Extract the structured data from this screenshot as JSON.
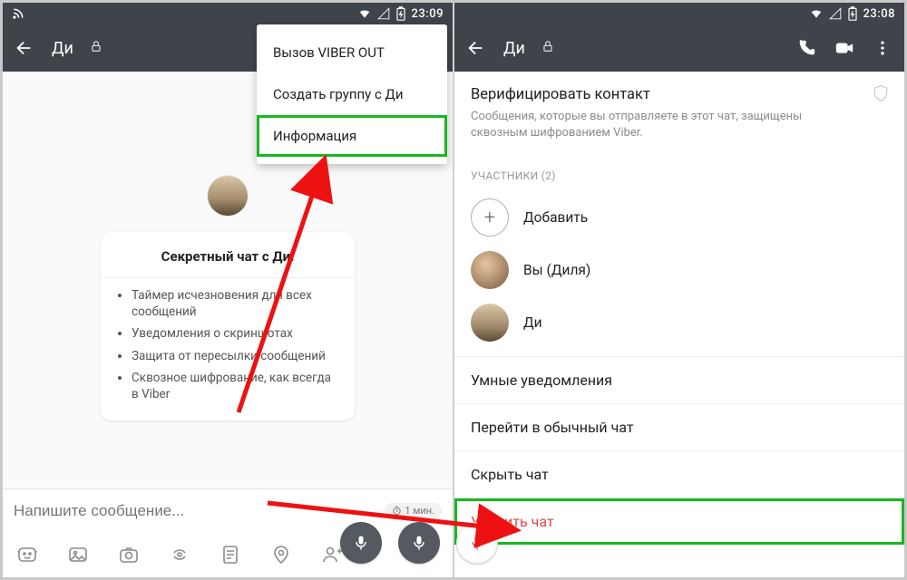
{
  "screen1": {
    "time": "23:09",
    "title": "Ди",
    "menu": {
      "item1": "Вызов VIBER OUT",
      "item2": "Создать группу с Ди",
      "item3": "Информация"
    },
    "secret_title": "Секретный чат с Ди:",
    "bullets": {
      "b1": "Таймер исчезновения для всех сообщений",
      "b2": "Уведомления о скриншотах",
      "b3": "Защита от пересылки сообщений",
      "b4": "Сквозное шифрование, как всегда в Viber"
    },
    "input_placeholder": "Напишите сообщение...",
    "timer_chip": "1 мин."
  },
  "screen2": {
    "time": "23:08",
    "title": "Ди",
    "verify_title": "Верифицировать контакт",
    "verify_sub": "Сообщения, которые вы отправляете в этот чат, защищены сквозным шифрованием Viber.",
    "participants_label": "УЧАСТНИКИ (2)",
    "add_label": "Добавить",
    "you_label": "Вы (Диля)",
    "other_label": "Ди",
    "opt_smart": "Умные уведомления",
    "opt_regular": "Перейти в обычный чат",
    "opt_hide": "Скрыть чат",
    "opt_delete": "Удалить чат"
  }
}
